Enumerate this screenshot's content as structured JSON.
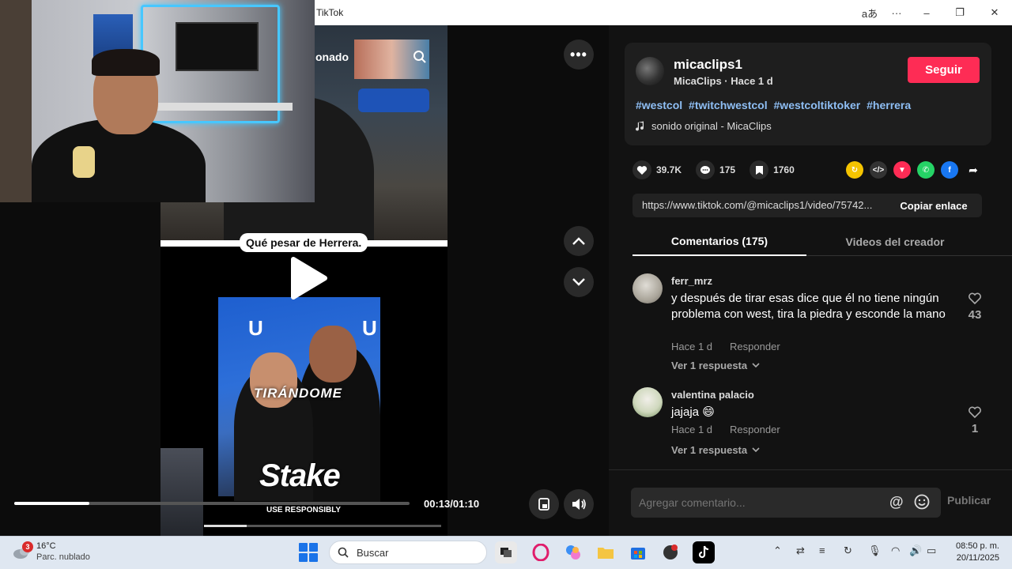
{
  "window": {
    "title": "TikTok",
    "translate_glyph": "aあ",
    "more_glyph": "···",
    "minimize_glyph": "–",
    "restore_glyph": "❐",
    "close_glyph": "✕"
  },
  "video": {
    "live_overlay_text": "onado",
    "caption": "Qué pesar de Herrera.",
    "overlay_text": "TIRÁNDOME",
    "logo_glyph": "U",
    "sponsor": "Stake",
    "sponsor_note": "USE RESPONSIBLY",
    "current_time": "00:13",
    "duration": "01:10",
    "time_readout": "00:13/01:10",
    "progress_fraction": 0.19,
    "more_glyph": "•••"
  },
  "author": {
    "username": "micaclips1",
    "subtitle": "MicaClips · Hace 1 d",
    "follow_label": "Seguir",
    "hashtags": [
      "#westcol",
      "#twitchwestcol",
      "#westcoltiktoker",
      "#herrera"
    ],
    "sound": "sonido original - MicaClips"
  },
  "stats": {
    "likes": "39.7K",
    "comments": "175",
    "saves": "1760"
  },
  "share": {
    "link": "https://www.tiktok.com/@micaclips1/video/75742...",
    "copy_label": "Copiar enlace"
  },
  "tabs": [
    {
      "label": "Comentarios (175)",
      "active": true
    },
    {
      "label": "Videos del creador",
      "active": false
    }
  ],
  "comments": [
    {
      "user": "ferr_mrz",
      "text": "y después de tirar esas dice que él no tiene ningún problema con west, tira la piedra y esconde la mano",
      "time": "Hace 1 d",
      "reply_label": "Responder",
      "replies_label": "Ver 1 respuesta",
      "likes": "43"
    },
    {
      "user": "valentina palacio",
      "text": "jajaja 😄",
      "time": "Hace 1 d",
      "reply_label": "Responder",
      "replies_label": "Ver 1 respuesta",
      "likes": "1"
    }
  ],
  "comment_box": {
    "placeholder": "Agregar comentario...",
    "at_glyph": "@",
    "publish_label": "Publicar"
  },
  "taskbar": {
    "weather_temp": "16°C",
    "weather_desc": "Parc. nublado",
    "weather_badge": "3",
    "search_placeholder": "Buscar",
    "time": "08:50 p. m.",
    "date": "20/11/2025"
  },
  "colors": {
    "accent": "#fe2c55",
    "hashtag": "#8fbff5",
    "panel_bg": "#121212"
  }
}
